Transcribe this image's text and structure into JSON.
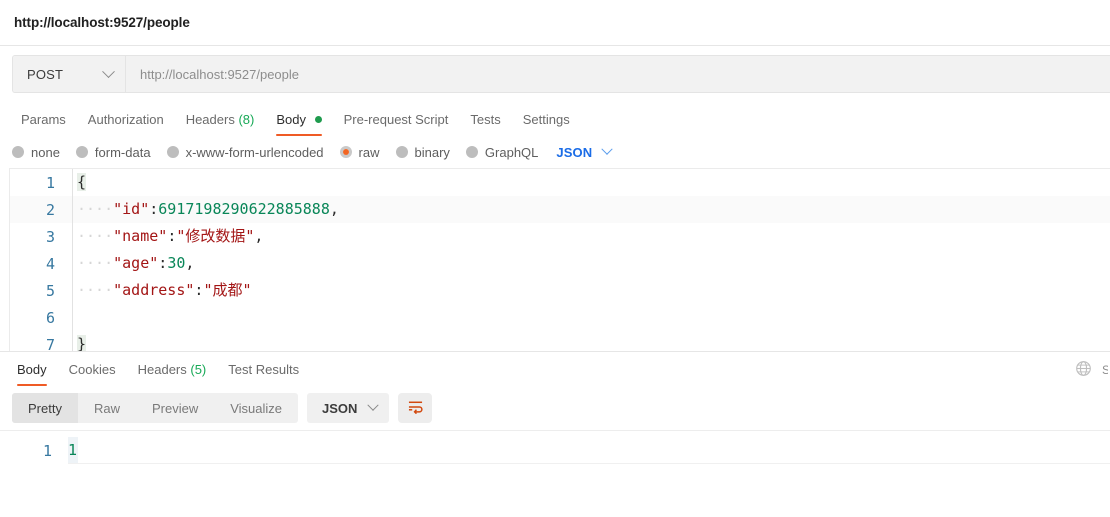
{
  "request": {
    "title": "http://localhost:9527/people",
    "method": "POST",
    "method_icon": "chevron-down-icon",
    "url": "http://localhost:9527/people",
    "tabs": [
      {
        "label": "Params",
        "count": "",
        "active": false,
        "dot": false
      },
      {
        "label": "Authorization",
        "count": "",
        "active": false,
        "dot": false
      },
      {
        "label": "Headers",
        "count": "(8)",
        "active": false,
        "dot": false
      },
      {
        "label": "Body",
        "count": "",
        "active": true,
        "dot": true
      },
      {
        "label": "Pre-request Script",
        "count": "",
        "active": false,
        "dot": false
      },
      {
        "label": "Tests",
        "count": "",
        "active": false,
        "dot": false
      },
      {
        "label": "Settings",
        "count": "",
        "active": false,
        "dot": false
      }
    ],
    "body_types": [
      {
        "label": "none",
        "selected": false
      },
      {
        "label": "form-data",
        "selected": false
      },
      {
        "label": "x-www-form-urlencoded",
        "selected": false
      },
      {
        "label": "raw",
        "selected": true
      },
      {
        "label": "binary",
        "selected": false
      },
      {
        "label": "GraphQL",
        "selected": false
      }
    ],
    "raw_format": "JSON",
    "raw_format_icon": "chevron-down-icon",
    "body_lines": [
      {
        "num": "1",
        "tokens": [
          {
            "t": "{",
            "c": "tok-brace"
          }
        ]
      },
      {
        "num": "2",
        "tokens": [
          {
            "t": "····",
            "c": "tok-indent"
          },
          {
            "t": "\"id\"",
            "c": "tok-key"
          },
          {
            "t": ":",
            "c": "tok-punct"
          },
          {
            "t": "6917198290622885888",
            "c": "tok-num"
          },
          {
            "t": ",",
            "c": "tok-punct"
          }
        ]
      },
      {
        "num": "3",
        "tokens": [
          {
            "t": "····",
            "c": "tok-indent"
          },
          {
            "t": "\"name\"",
            "c": "tok-key"
          },
          {
            "t": ":",
            "c": "tok-punct"
          },
          {
            "t": "\"修改数据\"",
            "c": "tok-cn"
          },
          {
            "t": ",",
            "c": "tok-punct"
          }
        ]
      },
      {
        "num": "4",
        "tokens": [
          {
            "t": "····",
            "c": "tok-indent"
          },
          {
            "t": "\"age\"",
            "c": "tok-key"
          },
          {
            "t": ":",
            "c": "tok-punct"
          },
          {
            "t": "30",
            "c": "tok-num"
          },
          {
            "t": ",",
            "c": "tok-punct"
          }
        ]
      },
      {
        "num": "5",
        "tokens": [
          {
            "t": "····",
            "c": "tok-indent"
          },
          {
            "t": "\"address\"",
            "c": "tok-key"
          },
          {
            "t": ":",
            "c": "tok-punct"
          },
          {
            "t": "\"成都\"",
            "c": "tok-cn"
          }
        ]
      },
      {
        "num": "6",
        "tokens": []
      },
      {
        "num": "7",
        "tokens": [
          {
            "t": "}",
            "c": "tok-brace"
          }
        ]
      }
    ]
  },
  "response": {
    "tabs": [
      {
        "label": "Body",
        "count": "",
        "active": true
      },
      {
        "label": "Cookies",
        "count": "",
        "active": false
      },
      {
        "label": "Headers",
        "count": "(5)",
        "active": false
      },
      {
        "label": "Test Results",
        "count": "",
        "active": false
      }
    ],
    "globe_icon": "globe-icon",
    "views": [
      {
        "label": "Pretty",
        "active": true
      },
      {
        "label": "Raw",
        "active": false
      },
      {
        "label": "Preview",
        "active": false
      },
      {
        "label": "Visualize",
        "active": false
      }
    ],
    "format": "JSON",
    "format_icon": "chevron-down-icon",
    "wrap_icon": "word-wrap-icon",
    "body_lines": [
      {
        "num": "1",
        "text": "1"
      }
    ]
  },
  "colors": {
    "accent": "#ef5b25",
    "link": "#1a6ce7",
    "success": "#18a957",
    "number": "#098658",
    "string": "#a31515"
  }
}
